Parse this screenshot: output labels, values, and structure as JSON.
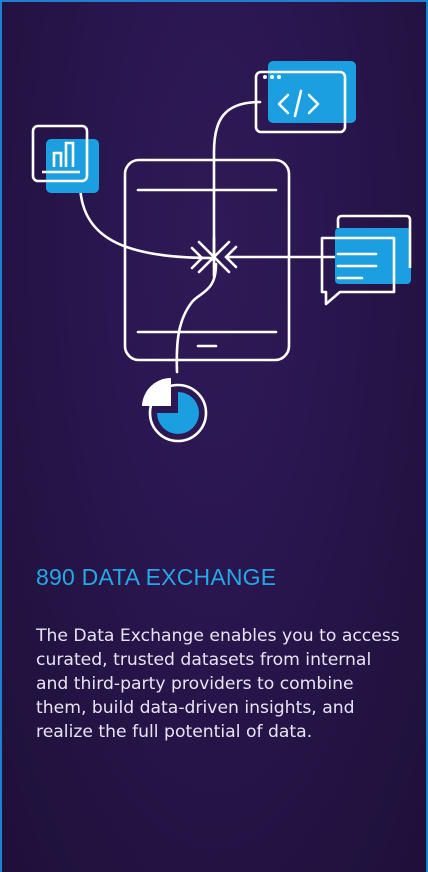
{
  "card": {
    "title": "890 DATA EXCHANGE",
    "description": "The Data Exchange enables you to access curated, trusted datasets from internal and third-party providers to combine them, build data-driven insights, and realize the full potential of data."
  },
  "illustration": {
    "icons": [
      "bar-chart-icon",
      "code-window-icon",
      "chat-bubbles-icon",
      "pie-chart-icon",
      "tablet-device-icon",
      "exchange-hub-icon"
    ]
  },
  "colors": {
    "background": "#281650",
    "border": "#1f7fd1",
    "accent": "#27a8e6",
    "text": "#e8e4f2",
    "line": "#ffffff"
  }
}
